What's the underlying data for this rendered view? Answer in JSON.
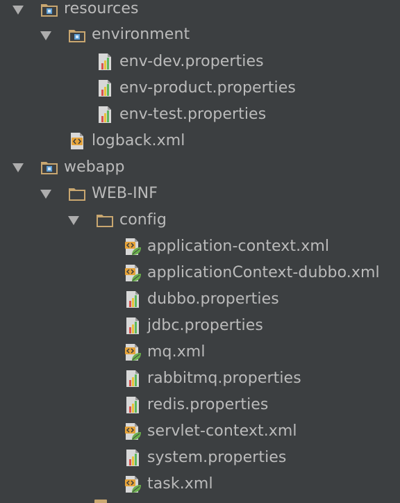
{
  "tree": {
    "nodes": [
      {
        "label": "resources",
        "kind": "resource-folder",
        "expanded": true
      },
      {
        "label": "environment",
        "kind": "resource-folder",
        "expanded": true
      },
      {
        "label": "env-dev.properties",
        "kind": "properties-file"
      },
      {
        "label": "env-product.properties",
        "kind": "properties-file"
      },
      {
        "label": "env-test.properties",
        "kind": "properties-file"
      },
      {
        "label": "logback.xml",
        "kind": "xml-file"
      },
      {
        "label": "webapp",
        "kind": "resource-folder",
        "expanded": true
      },
      {
        "label": "WEB-INF",
        "kind": "folder",
        "expanded": true
      },
      {
        "label": "config",
        "kind": "folder",
        "expanded": true
      },
      {
        "label": "application-context.xml",
        "kind": "spring-xml-file"
      },
      {
        "label": "applicationContext-dubbo.xml",
        "kind": "spring-xml-file"
      },
      {
        "label": "dubbo.properties",
        "kind": "properties-file"
      },
      {
        "label": "jdbc.properties",
        "kind": "properties-file"
      },
      {
        "label": "mq.xml",
        "kind": "spring-xml-file"
      },
      {
        "label": "rabbitmq.properties",
        "kind": "properties-file"
      },
      {
        "label": "redis.properties",
        "kind": "properties-file"
      },
      {
        "label": "servlet-context.xml",
        "kind": "spring-xml-file"
      },
      {
        "label": "system.properties",
        "kind": "properties-file"
      },
      {
        "label": "task.xml",
        "kind": "spring-xml-file"
      }
    ]
  },
  "colors": {
    "background": "#3c3f41",
    "text": "#bbbbbb",
    "folder": "#c9a770",
    "resource_marker": "#5e9fd6",
    "arrow": "#adadad",
    "xml_badge": "#e5a33a",
    "spring_leaf": "#6aaf4c",
    "bar_red": "#d9534f",
    "bar_yellow": "#e8c23a",
    "bar_green": "#5cb85c"
  }
}
